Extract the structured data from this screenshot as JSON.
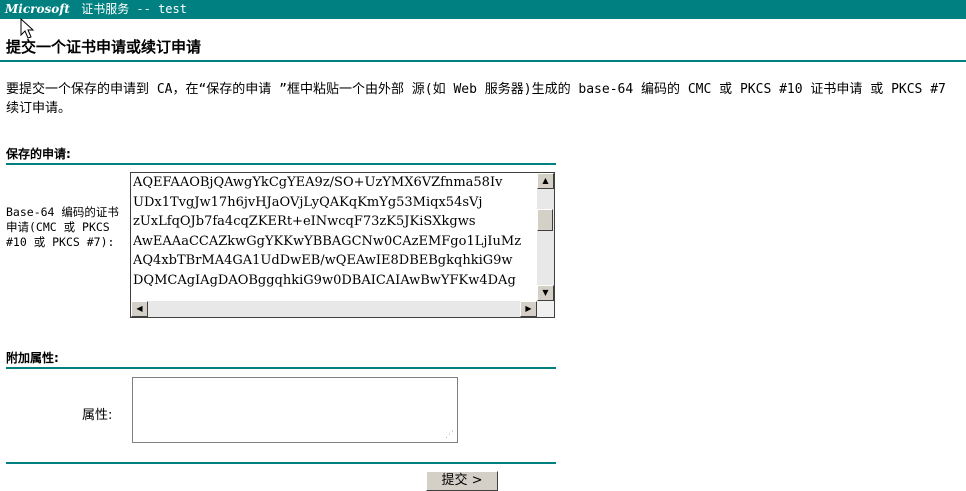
{
  "banner": {
    "brand": "Microsoft",
    "app_title": "证书服务 -- test"
  },
  "page": {
    "title": "提交一个证书申请或续订申请",
    "intro": "要提交一个保存的申请到 CA，在“保存的申请 ”框中粘贴一个由外部 源(如 Web 服务器)生成的 base-64 编码的 CMC 或 PKCS #10 证书申请 或 PKCS #7 续订申请。"
  },
  "saved_request": {
    "heading": "保存的申请:",
    "field_label": "Base-64 编码的证书申请(CMC 或 PKCS #10 或 PKCS #7):",
    "lines": [
      "AQEFAAOBjQAwgYkCgYEA9z/SO+UzYMX6VZfnma58Iv",
      "UDx1TvgJw17h6jvHJaOVjLyQAKqKmYg53Miqx54sVj",
      "zUxLfqOJb7fa4cqZKERt+eINwcqF73zK5JKiSXkgws",
      "AwEAAaCCAZkwGgYKKwYBBAGCNw0CAzEMFgo1LjIuMz",
      "AQ4xbTBrMA4GA1UdDwEB/wQEAwIE8DBEBgkqhkiG9w",
      "DQMCAgIAgDAOBggqhkiG9w0DBAICAIAwBwYFKw4DAg"
    ]
  },
  "attributes": {
    "heading": "附加属性:",
    "label": "属性:",
    "value": ""
  },
  "actions": {
    "submit_label": "提交 >"
  }
}
